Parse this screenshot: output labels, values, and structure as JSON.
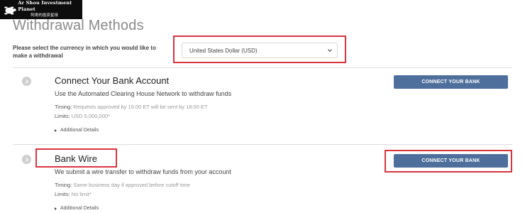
{
  "watermark": {
    "title": "Ar Shou Investment Planet",
    "subtitle": "阿寿的投资星球",
    "icon": "turtle-icon"
  },
  "page": {
    "title": "Withdrawal Methods",
    "currency_prompt": "Please select the currency in which you would like to make a withdrawal",
    "currency_selected": "United States Dollar (USD)"
  },
  "methods": [
    {
      "title": "Connect Your Bank Account",
      "description": "Use the Automated Clearing House Network to withdraw funds",
      "timing_label": "Timing:",
      "timing_value": "Requests approved by 16:00 ET will be sent by 18:00 ET",
      "limits_label": "Limits:",
      "limits_value": "USD 5,000,000*",
      "details_label": "Additional Details",
      "button_label": "CONNECT YOUR BANK"
    },
    {
      "title": "Bank Wire",
      "description": "We submit a wire transfer to withdraw funds from your account",
      "timing_label": "Timing:",
      "timing_value": "Same business day if approved before cutoff time",
      "limits_label": "Limits:",
      "limits_value": "No limit*",
      "details_label": "Additional Details",
      "button_label": "CONNECT YOUR BANK"
    }
  ],
  "colors": {
    "button": "#4e6f9c",
    "highlight": "#d9333f"
  }
}
